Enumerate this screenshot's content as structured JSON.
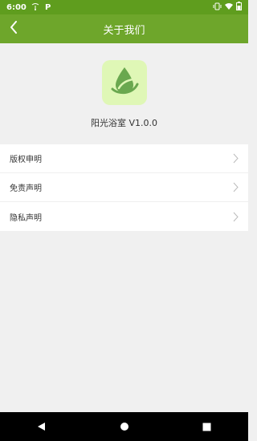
{
  "status_bar": {
    "time": "6:00",
    "icons": [
      "cast-icon",
      "parking-icon",
      "vibrate-icon",
      "wifi-icon",
      "battery-icon"
    ]
  },
  "app_bar": {
    "title": "关于我们",
    "back_icon": "chevron-left-icon"
  },
  "about": {
    "logo_icon": "water-drop-leaf-icon",
    "logo_bg": "#dff7b6",
    "app_name_version": "阳光浴室 V1.0.0"
  },
  "menu": {
    "items": [
      {
        "label": "版权申明"
      },
      {
        "label": "免责声明"
      },
      {
        "label": "隐私声明"
      }
    ]
  },
  "nav_bar": {
    "buttons": [
      "back-triangle-icon",
      "home-circle-icon",
      "recents-square-icon"
    ]
  },
  "colors": {
    "status_bar": "#5f9d1e",
    "app_bar": "#6ea62b",
    "background": "#f0f0f0"
  }
}
